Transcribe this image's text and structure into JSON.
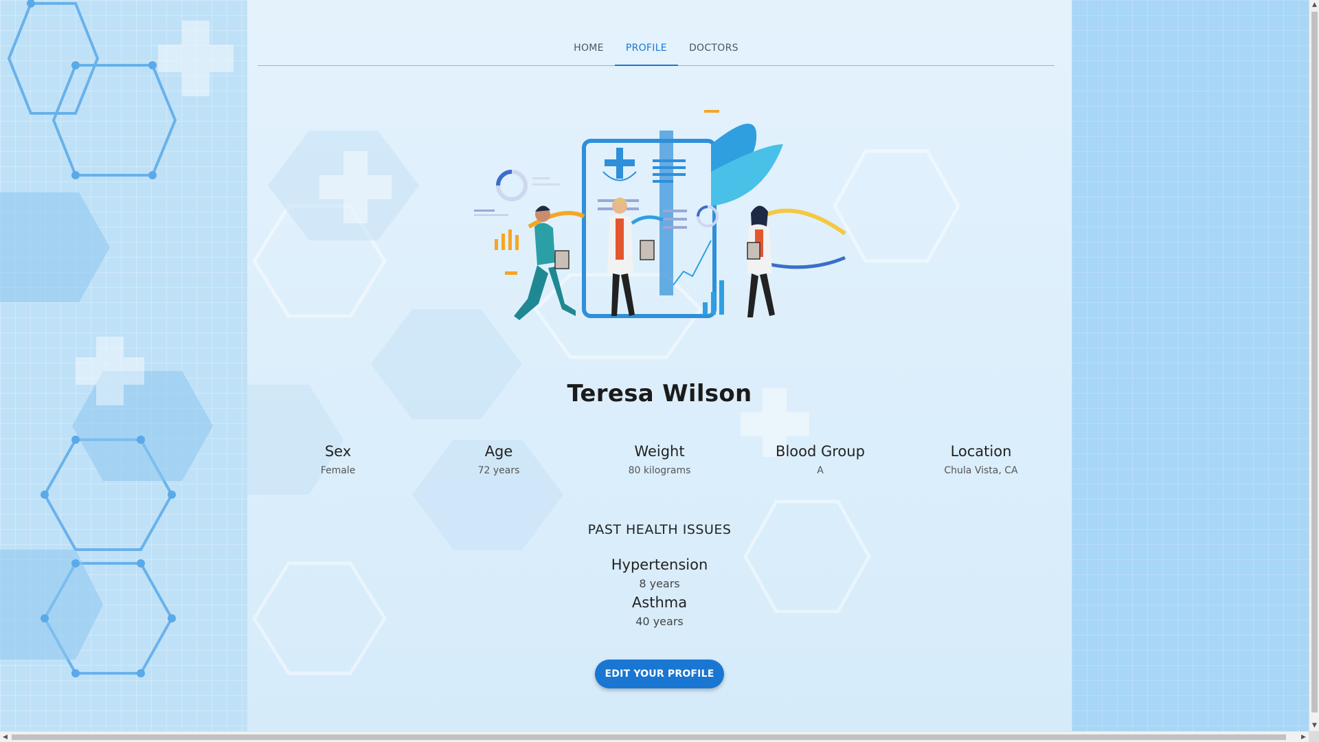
{
  "nav": {
    "tabs": [
      {
        "label": "HOME",
        "active": false
      },
      {
        "label": "PROFILE",
        "active": true
      },
      {
        "label": "DOCTORS",
        "active": false
      }
    ]
  },
  "profile": {
    "name": "Teresa Wilson",
    "stats": [
      {
        "label": "Sex",
        "value": "Female"
      },
      {
        "label": "Age",
        "value": "72 years"
      },
      {
        "label": "Weight",
        "value": "80 kilograms"
      },
      {
        "label": "Blood Group",
        "value": "A"
      },
      {
        "label": "Location",
        "value": "Chula Vista, CA"
      }
    ]
  },
  "health": {
    "title": "PAST HEALTH ISSUES",
    "issues": [
      {
        "name": "Hypertension",
        "duration": "8 years"
      },
      {
        "name": "Asthma",
        "duration": "40 years"
      }
    ]
  },
  "actions": {
    "edit_label": "EDIT YOUR PROFILE"
  },
  "colors": {
    "accent": "#1976d2",
    "background": "#dff0fb"
  },
  "icons": {
    "illustration": "doctors-team-illustration",
    "scroll_up": "arrow-up-icon",
    "scroll_down": "arrow-down-icon",
    "scroll_left": "arrow-left-icon",
    "scroll_right": "arrow-right-icon"
  }
}
